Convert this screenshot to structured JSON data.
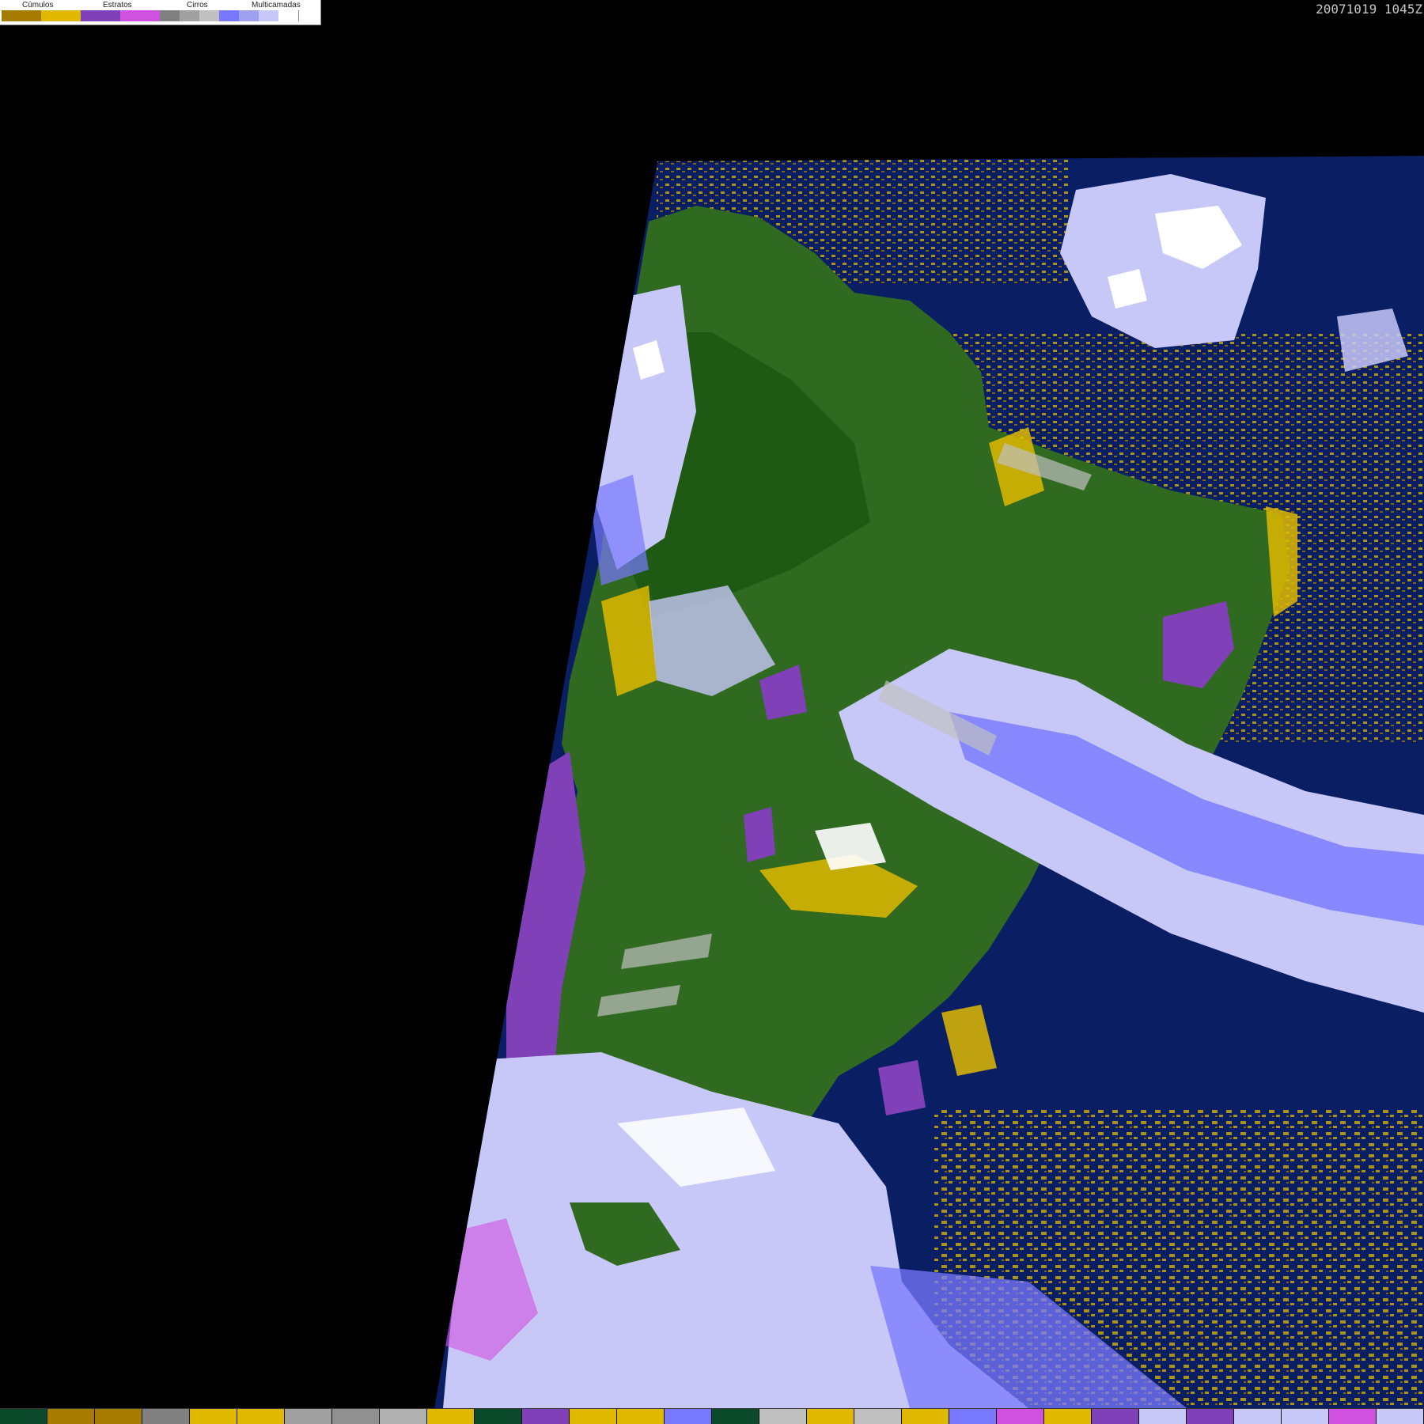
{
  "legend": {
    "groups": [
      {
        "label": "Cúmulos",
        "colors": [
          "#a67c00",
          "#e0b800"
        ]
      },
      {
        "label": "Estratos",
        "colors": [
          "#8040b8",
          "#d050e0"
        ]
      },
      {
        "label": "Cirros",
        "colors": [
          "#808080",
          "#a0a0a0",
          "#c0c0c0"
        ]
      },
      {
        "label": "Multicamadas",
        "colors": [
          "#7878ff",
          "#a0a0f0",
          "#c8c8f8",
          "#ffffff"
        ]
      }
    ]
  },
  "timestamp": "20071019 1045Z",
  "colors": {
    "ocean": "#0a1e64",
    "land": "#2f6a20",
    "land_dark": "#1e5a14",
    "cumulus": "#e0b800",
    "cumulus_dark": "#a67c00",
    "stratus": "#8040b8",
    "stratus_light": "#d050e0",
    "cirrus": "#c0c0c0",
    "multilayer": "#c8c8f8",
    "multilayer_dark": "#7878ff"
  },
  "bottom_bar": [
    "#0a4a2a",
    "#a67c00",
    "#a67c00",
    "#808080",
    "#e0b800",
    "#e0b800",
    "#a0a0a0",
    "#909090",
    "#b0b0b0",
    "#e0b800",
    "#0a4a2a",
    "#8040b8",
    "#e0b800",
    "#e0b800",
    "#7878ff",
    "#0a4a2a",
    "#c0c0c0",
    "#e0b800",
    "#c0c0c0",
    "#e0b800",
    "#7878ff",
    "#d050e0",
    "#e0b800",
    "#8040b8",
    "#c8c8f8",
    "#8040b8",
    "#c8c8f8",
    "#c8c8f8",
    "#d050e0",
    "#c8c8f8"
  ]
}
